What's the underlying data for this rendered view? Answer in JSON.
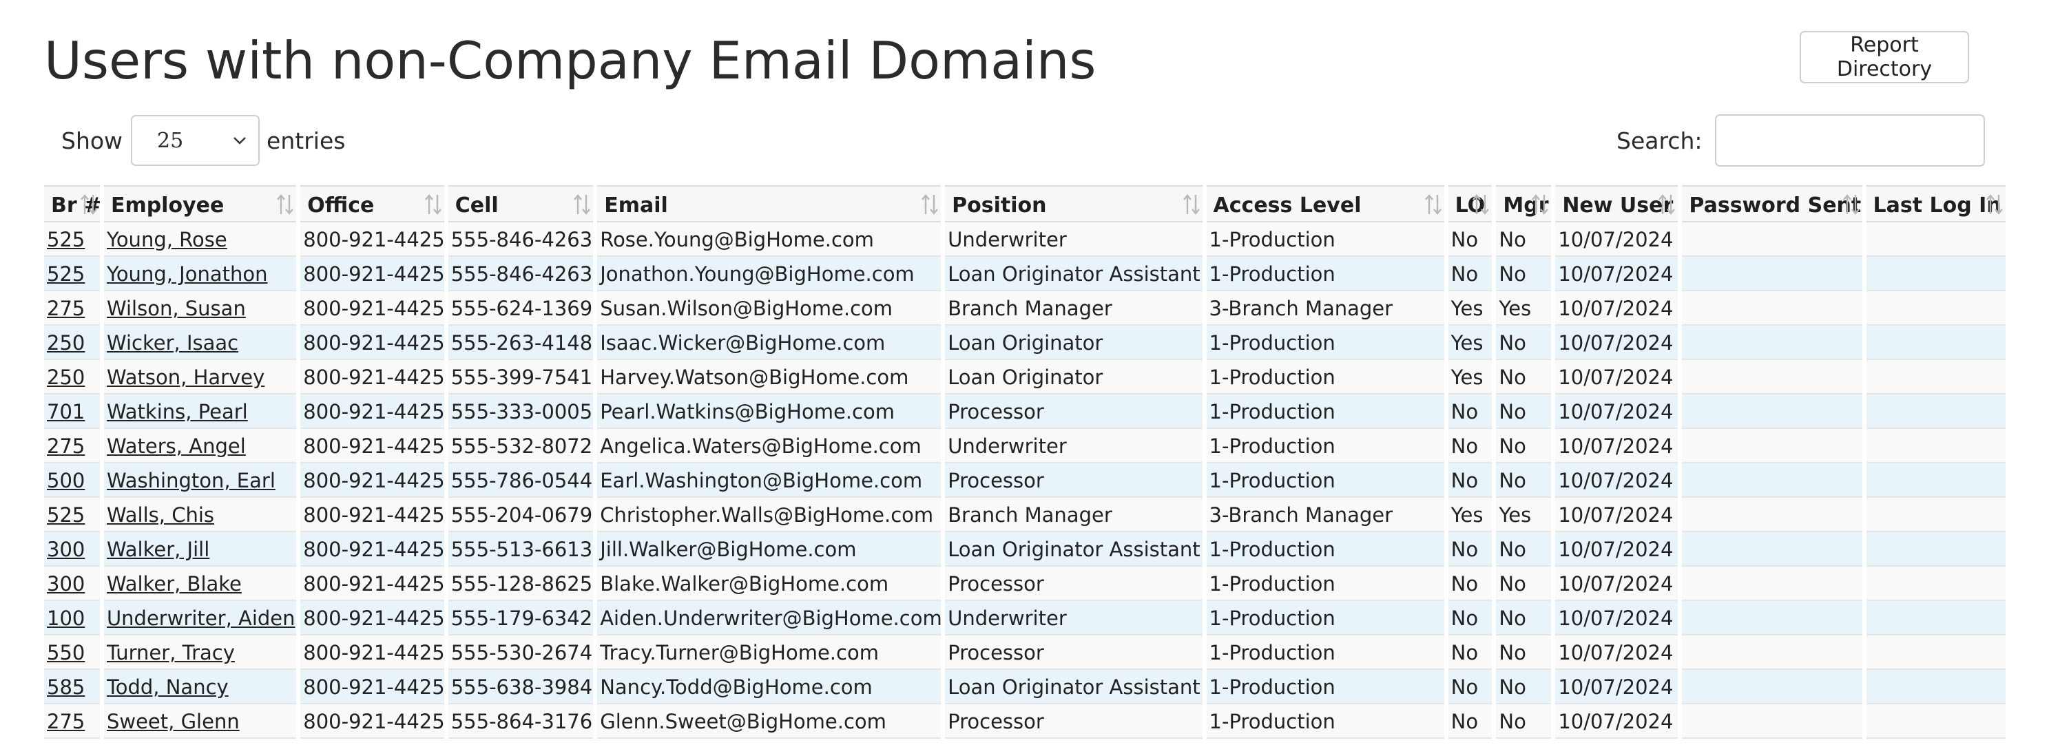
{
  "page": {
    "title": "Users with non-Company Email Domains",
    "report_button": "Report Directory"
  },
  "length_control": {
    "show_label": "Show",
    "selected": "25",
    "entries_label": "entries"
  },
  "search": {
    "label": "Search:",
    "value": "",
    "placeholder": ""
  },
  "table": {
    "columns": [
      "Br #",
      "Employee",
      "Office",
      "Cell",
      "Email",
      "Position",
      "Access Level",
      "LO",
      "Mgr",
      "New User",
      "Password Sent",
      "Last Log In"
    ],
    "rows": [
      {
        "br": "525",
        "employee": "Young, Rose",
        "office": "800-921-4425",
        "cell": "555-846-4263",
        "email": "Rose.Young@BigHome.com",
        "position": "Underwriter",
        "access": "1-Production",
        "lo": "No",
        "mgr": "No",
        "new_user": "10/07/2024",
        "password_sent": "",
        "last_login": ""
      },
      {
        "br": "525",
        "employee": "Young, Jonathon",
        "office": "800-921-4425",
        "cell": "555-846-4263",
        "email": "Jonathon.Young@BigHome.com",
        "position": "Loan Originator Assistant",
        "access": "1-Production",
        "lo": "No",
        "mgr": "No",
        "new_user": "10/07/2024",
        "password_sent": "",
        "last_login": ""
      },
      {
        "br": "275",
        "employee": "Wilson, Susan",
        "office": "800-921-4425",
        "cell": "555-624-1369",
        "email": "Susan.Wilson@BigHome.com",
        "position": "Branch Manager",
        "access": "3-Branch Manager",
        "lo": "Yes",
        "mgr": "Yes",
        "new_user": "10/07/2024",
        "password_sent": "",
        "last_login": ""
      },
      {
        "br": "250",
        "employee": "Wicker, Isaac",
        "office": "800-921-4425",
        "cell": "555-263-4148",
        "email": "Isaac.Wicker@BigHome.com",
        "position": "Loan Originator",
        "access": "1-Production",
        "lo": "Yes",
        "mgr": "No",
        "new_user": "10/07/2024",
        "password_sent": "",
        "last_login": ""
      },
      {
        "br": "250",
        "employee": "Watson, Harvey",
        "office": "800-921-4425",
        "cell": "555-399-7541",
        "email": "Harvey.Watson@BigHome.com",
        "position": "Loan Originator",
        "access": "1-Production",
        "lo": "Yes",
        "mgr": "No",
        "new_user": "10/07/2024",
        "password_sent": "",
        "last_login": ""
      },
      {
        "br": "701",
        "employee": "Watkins, Pearl",
        "office": "800-921-4425",
        "cell": "555-333-0005",
        "email": "Pearl.Watkins@BigHome.com",
        "position": "Processor",
        "access": "1-Production",
        "lo": "No",
        "mgr": "No",
        "new_user": "10/07/2024",
        "password_sent": "",
        "last_login": ""
      },
      {
        "br": "275",
        "employee": "Waters, Angel",
        "office": "800-921-4425",
        "cell": "555-532-8072",
        "email": "Angelica.Waters@BigHome.com",
        "position": "Underwriter",
        "access": "1-Production",
        "lo": "No",
        "mgr": "No",
        "new_user": "10/07/2024",
        "password_sent": "",
        "last_login": ""
      },
      {
        "br": "500",
        "employee": "Washington, Earl",
        "office": "800-921-4425",
        "cell": "555-786-0544",
        "email": "Earl.Washington@BigHome.com",
        "position": "Processor",
        "access": "1-Production",
        "lo": "No",
        "mgr": "No",
        "new_user": "10/07/2024",
        "password_sent": "",
        "last_login": ""
      },
      {
        "br": "525",
        "employee": "Walls, Chis",
        "office": "800-921-4425",
        "cell": "555-204-0679",
        "email": "Christopher.Walls@BigHome.com",
        "position": "Branch Manager",
        "access": "3-Branch Manager",
        "lo": "Yes",
        "mgr": "Yes",
        "new_user": "10/07/2024",
        "password_sent": "",
        "last_login": ""
      },
      {
        "br": "300",
        "employee": "Walker, Jill",
        "office": "800-921-4425",
        "cell": "555-513-6613",
        "email": "Jill.Walker@BigHome.com",
        "position": "Loan Originator Assistant",
        "access": "1-Production",
        "lo": "No",
        "mgr": "No",
        "new_user": "10/07/2024",
        "password_sent": "",
        "last_login": ""
      },
      {
        "br": "300",
        "employee": "Walker, Blake",
        "office": "800-921-4425",
        "cell": "555-128-8625",
        "email": "Blake.Walker@BigHome.com",
        "position": "Processor",
        "access": "1-Production",
        "lo": "No",
        "mgr": "No",
        "new_user": "10/07/2024",
        "password_sent": "",
        "last_login": ""
      },
      {
        "br": "100",
        "employee": "Underwriter, Aiden",
        "office": "800-921-4425",
        "cell": "555-179-6342",
        "email": "Aiden.Underwriter@BigHome.com",
        "position": "Underwriter",
        "access": "1-Production",
        "lo": "No",
        "mgr": "No",
        "new_user": "10/07/2024",
        "password_sent": "",
        "last_login": ""
      },
      {
        "br": "550",
        "employee": "Turner, Tracy",
        "office": "800-921-4425",
        "cell": "555-530-2674",
        "email": "Tracy.Turner@BigHome.com",
        "position": "Processor",
        "access": "1-Production",
        "lo": "No",
        "mgr": "No",
        "new_user": "10/07/2024",
        "password_sent": "",
        "last_login": ""
      },
      {
        "br": "585",
        "employee": "Todd, Nancy",
        "office": "800-921-4425",
        "cell": "555-638-3984",
        "email": "Nancy.Todd@BigHome.com",
        "position": "Loan Originator Assistant",
        "access": "1-Production",
        "lo": "No",
        "mgr": "No",
        "new_user": "10/07/2024",
        "password_sent": "",
        "last_login": ""
      },
      {
        "br": "275",
        "employee": "Sweet, Glenn",
        "office": "800-921-4425",
        "cell": "555-864-3176",
        "email": "Glenn.Sweet@BigHome.com",
        "position": "Processor",
        "access": "1-Production",
        "lo": "No",
        "mgr": "No",
        "new_user": "10/07/2024",
        "password_sent": "",
        "last_login": ""
      }
    ]
  }
}
